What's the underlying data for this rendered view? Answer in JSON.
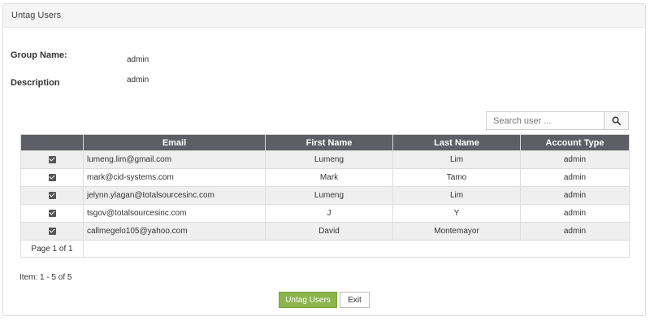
{
  "panel": {
    "title": "Untag Users"
  },
  "form": {
    "group_label": "Group Name:",
    "group_value": "admin",
    "desc_label": "Description",
    "desc_value": "admin"
  },
  "search": {
    "placeholder": "Search user ...",
    "icon": "search-icon"
  },
  "table": {
    "headers": [
      "",
      "Email",
      "First Name",
      "Last Name",
      "Account Type"
    ],
    "rows": [
      {
        "checked": true,
        "email": "lumeng.lim@gmail.com",
        "first": "Lumeng",
        "last": "Lim",
        "type": "admin"
      },
      {
        "checked": true,
        "email": "mark@cid-systems.com",
        "first": "Mark",
        "last": "Tamo",
        "type": "admin"
      },
      {
        "checked": true,
        "email": "jelynn.ylagan@totalsourcesinc.com",
        "first": "Lumeng",
        "last": "Lim",
        "type": "admin"
      },
      {
        "checked": true,
        "email": "tsgov@totalsourcesinc.com",
        "first": "J",
        "last": "Y",
        "type": "admin"
      },
      {
        "checked": true,
        "email": "callmegelo105@yahoo.com",
        "first": "David",
        "last": "Montemayor",
        "type": "admin"
      }
    ],
    "pager": "Page 1 of 1"
  },
  "footer": {
    "item_count": "Item: 1 - 5 of 5",
    "untag_label": "Untag Users",
    "exit_label": "Exit"
  },
  "colors": {
    "header_bg": "#5e5e66",
    "primary_button": "#8bb44b"
  }
}
